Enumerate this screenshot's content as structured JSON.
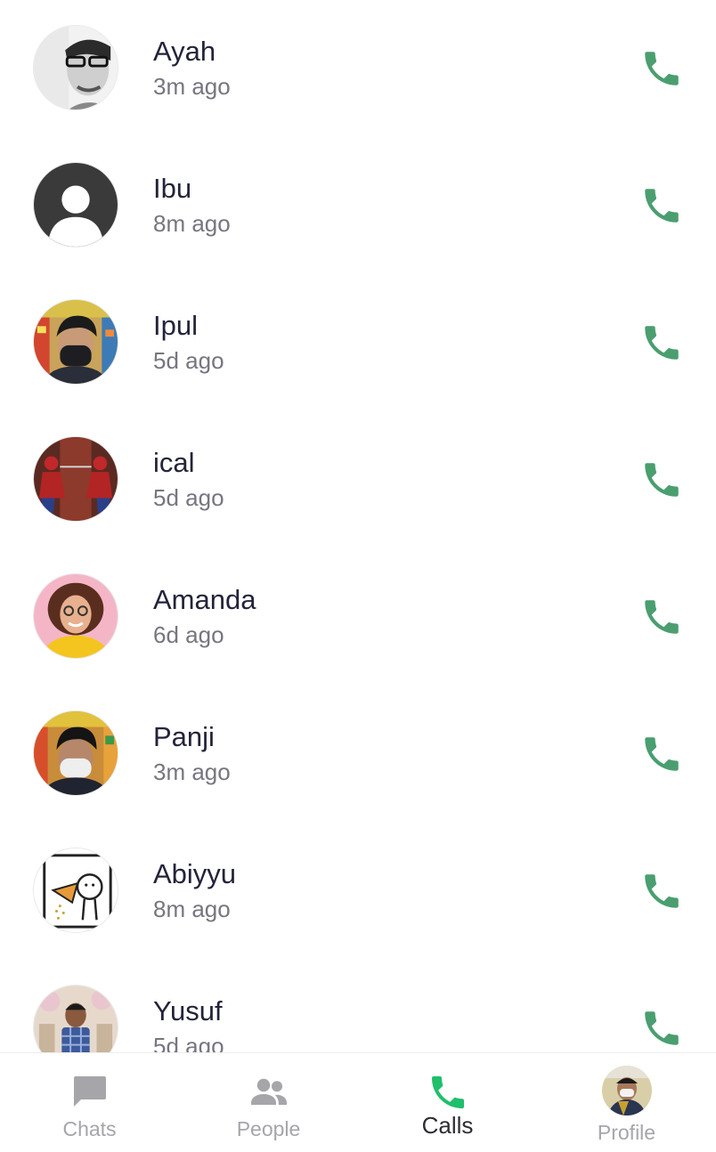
{
  "calls": [
    {
      "name": "Ayah",
      "time": "3m ago"
    },
    {
      "name": "Ibu",
      "time": "8m ago"
    },
    {
      "name": "Ipul",
      "time": "5d ago"
    },
    {
      "name": "ical",
      "time": "5d ago"
    },
    {
      "name": "Amanda",
      "time": "6d ago"
    },
    {
      "name": "Panji",
      "time": "3m ago"
    },
    {
      "name": "Abiyyu",
      "time": "8m ago"
    },
    {
      "name": "Yusuf",
      "time": "5d ago"
    }
  ],
  "nav": {
    "chats": "Chats",
    "people": "People",
    "calls": "Calls",
    "profile": "Profile"
  },
  "colors": {
    "call_icon": "#4a9e6f",
    "active_nav_icon": "#1fbf6b",
    "inactive_nav": "#a5a5aa"
  }
}
